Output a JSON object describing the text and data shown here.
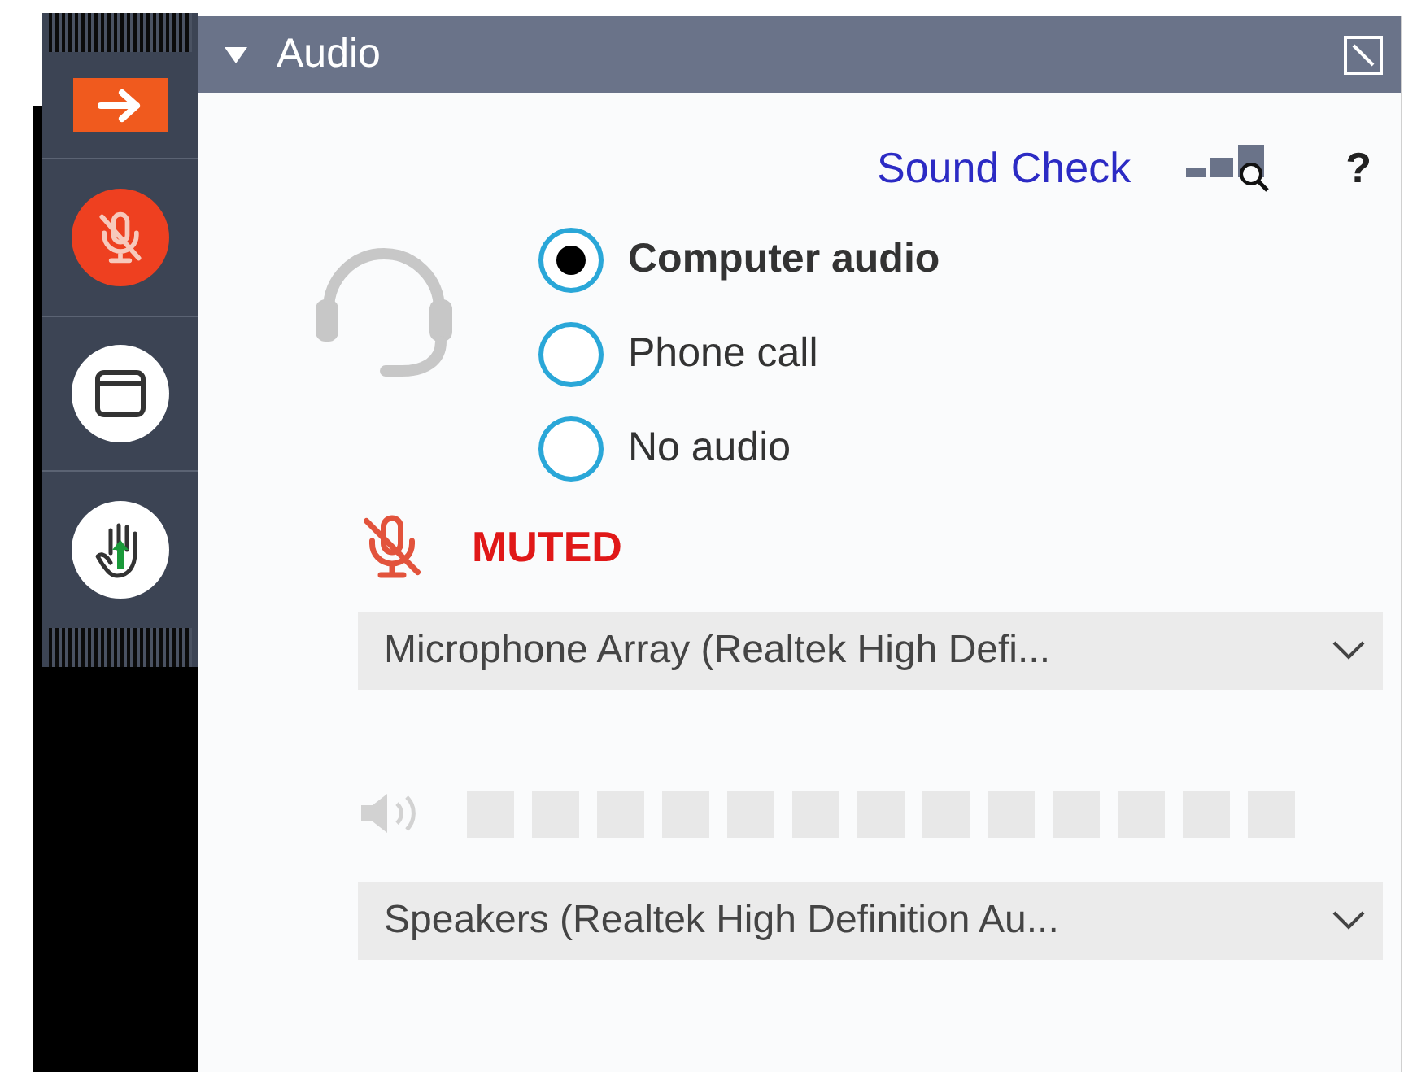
{
  "panel": {
    "title": "Audio",
    "expanded": true
  },
  "sound_check": "Sound Check",
  "help": "?",
  "audio_options": [
    {
      "label": "Computer audio",
      "selected": true
    },
    {
      "label": "Phone call",
      "selected": false
    },
    {
      "label": "No audio",
      "selected": false
    }
  ],
  "mic_status": "MUTED",
  "microphone_select": {
    "value": "Microphone Array (Realtek High Defi..."
  },
  "speaker_select": {
    "value": "Speakers (Realtek High Definition Au..."
  }
}
